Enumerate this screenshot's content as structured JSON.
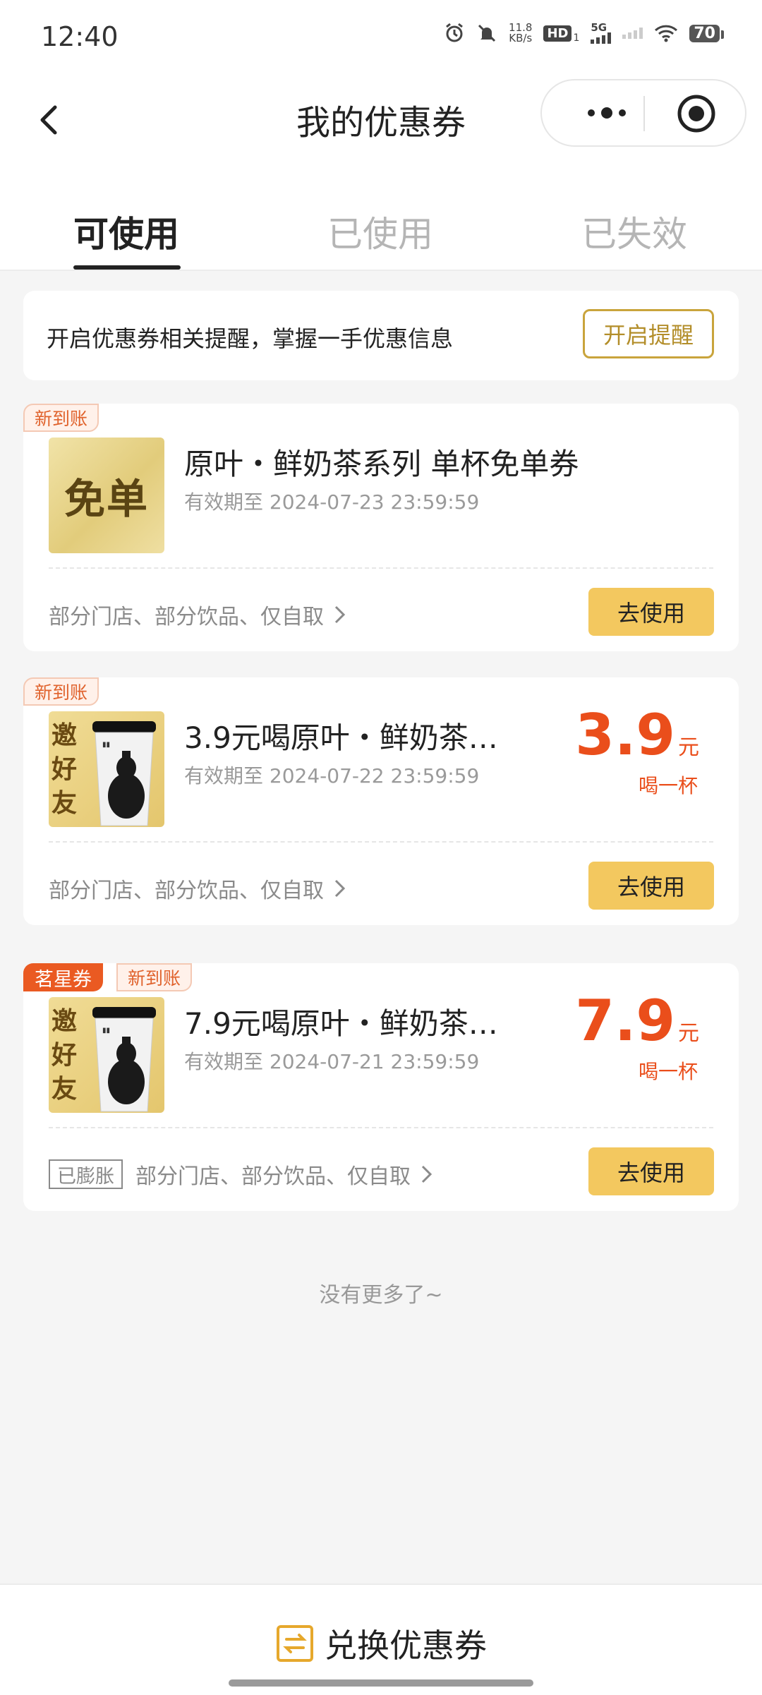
{
  "status_bar": {
    "time": "12:40",
    "net_speed_value": "11.8",
    "net_speed_unit": "KB/s",
    "hd_label": "HD",
    "hd_sub": "1",
    "signal_label": "5G",
    "battery": "70"
  },
  "nav": {
    "title": "我的优惠券"
  },
  "tabs": [
    {
      "label": "可使用",
      "active": true
    },
    {
      "label": "已使用",
      "active": false
    },
    {
      "label": "已失效",
      "active": false
    }
  ],
  "reminder": {
    "text": "开启优惠券相关提醒，掌握一手优惠信息",
    "button": "开启提醒"
  },
  "coupons": [
    {
      "new_tag": "新到账",
      "thumb_text": "免单",
      "title": "原叶・鲜奶茶系列 单杯免单券",
      "expire": "有效期至 2024-07-23 23:59:59",
      "scope": "部分门店、部分饮品、仅自取",
      "button": "去使用"
    },
    {
      "new_tag": "新到账",
      "thumb_text": "邀好友",
      "title": "3.9元喝原叶・鲜奶茶…",
      "expire": "有效期至 2024-07-22 23:59:59",
      "price": "3.9",
      "price_unit": "元",
      "price_desc": "喝一杯",
      "scope": "部分门店、部分饮品、仅自取",
      "button": "去使用"
    },
    {
      "star_tag": "茗星券",
      "new_tag": "新到账",
      "thumb_text": "邀好友",
      "title": "7.9元喝原叶・鲜奶茶…",
      "expire": "有效期至 2024-07-21 23:59:59",
      "price": "7.9",
      "price_unit": "元",
      "price_desc": "喝一杯",
      "badge": "已膨胀",
      "scope": "部分门店、部分饮品、仅自取",
      "button": "去使用"
    }
  ],
  "no_more": "没有更多了~",
  "bottom": {
    "redeem_label": "兑换优惠券"
  },
  "colors": {
    "accent_gold": "#f3c85f",
    "price_orange": "#ea4e1b",
    "tag_orange": "#ea5a22"
  }
}
